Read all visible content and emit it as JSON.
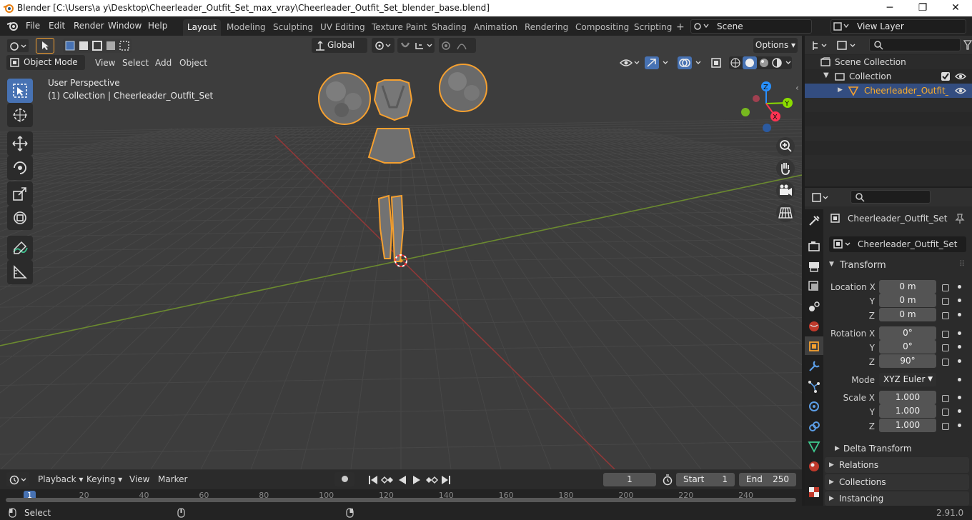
{
  "window": {
    "title": "Blender [C:\\Users\\a y\\Desktop\\Cheerleader_Outfit_Set_max_vray\\Cheerleader_Outfit_Set_blender_base.blend]",
    "minimize": "─",
    "maximize": "❐",
    "close": "✕"
  },
  "menu": [
    "File",
    "Edit",
    "Render",
    "Window",
    "Help"
  ],
  "workspaces": [
    "Layout",
    "Modeling",
    "Sculpting",
    "UV Editing",
    "Texture Paint",
    "Shading",
    "Animation",
    "Rendering",
    "Compositing",
    "Scripting"
  ],
  "add_workspace": "+",
  "scene": "Scene",
  "view_layer": "View Layer",
  "toolbar": {
    "orientation": "Global",
    "options": "Options"
  },
  "viewport": {
    "mode": "Object Mode",
    "view": "View",
    "select": "Select",
    "add": "Add",
    "object": "Object",
    "perspective": "User Perspective",
    "collection_info": "(1) Collection | Cheerleader_Outfit_Set"
  },
  "gizmo": {
    "x": "X",
    "y": "Y",
    "z": "Z"
  },
  "colors": {
    "accent": "#4772b3",
    "x_axis": "#ff3352",
    "y_axis": "#8bdc00",
    "z_axis": "#2890ff",
    "selection": "#f5a030"
  },
  "outliner": {
    "scene_collection": "Scene Collection",
    "collection": "Collection",
    "object": "Cheerleader_Outfit_Set"
  },
  "properties": {
    "object_name": "Cheerleader_Outfit_Set",
    "data_name": "Cheerleader_Outfit_Set",
    "transform": "Transform",
    "location_label": "Location X",
    "y": "Y",
    "z": "Z",
    "location": [
      "0 m",
      "0 m",
      "0 m"
    ],
    "rotation_label": "Rotation X",
    "rotation": [
      "0°",
      "0°",
      "90°"
    ],
    "mode_label": "Mode",
    "mode": "XYZ Euler",
    "scale_label": "Scale X",
    "scale": [
      "1.000",
      "1.000",
      "1.000"
    ],
    "delta": "Delta Transform",
    "relations": "Relations",
    "collections": "Collections",
    "instancing": "Instancing"
  },
  "timeline": {
    "playback": "Playback",
    "keying": "Keying",
    "view": "View",
    "marker": "Marker",
    "current": "1",
    "start_label": "Start",
    "start": "1",
    "end_label": "End",
    "end": "250",
    "ticks": [
      "1",
      "20",
      "40",
      "60",
      "80",
      "100",
      "120",
      "140",
      "160",
      "180",
      "200",
      "220",
      "240"
    ]
  },
  "status": {
    "select": "Select",
    "version": "2.91.0"
  }
}
